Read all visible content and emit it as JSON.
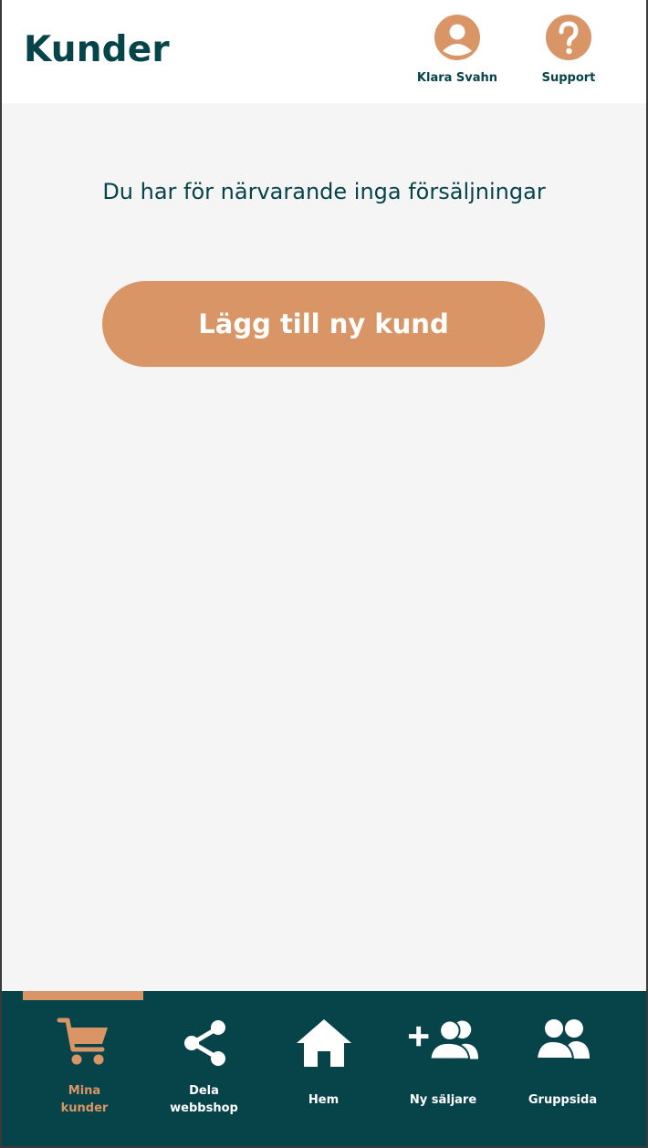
{
  "header": {
    "title": "Kunder",
    "profile_label": "Klara Svahn",
    "support_label": "Support",
    "profile_icon": "user-circle-icon",
    "support_icon": "question-circle-icon"
  },
  "main": {
    "empty_message": "Du har för närvarande inga försäljningar",
    "add_button_label": "Lägg till ny kund"
  },
  "nav": {
    "active_index": 0,
    "items": [
      {
        "label_line1": "Mina",
        "label_line2": "kunder",
        "icon": "cart-icon"
      },
      {
        "label_line1": "Dela",
        "label_line2": "webbshop",
        "icon": "share-icon"
      },
      {
        "label": "Hem",
        "icon": "home-icon"
      },
      {
        "label": "Ny säljare",
        "icon": "add-users-icon"
      },
      {
        "label": "Gruppsida",
        "icon": "group-icon"
      }
    ]
  },
  "colors": {
    "primary": "#06444a",
    "accent": "#d99566",
    "background": "#f5f5f5"
  }
}
